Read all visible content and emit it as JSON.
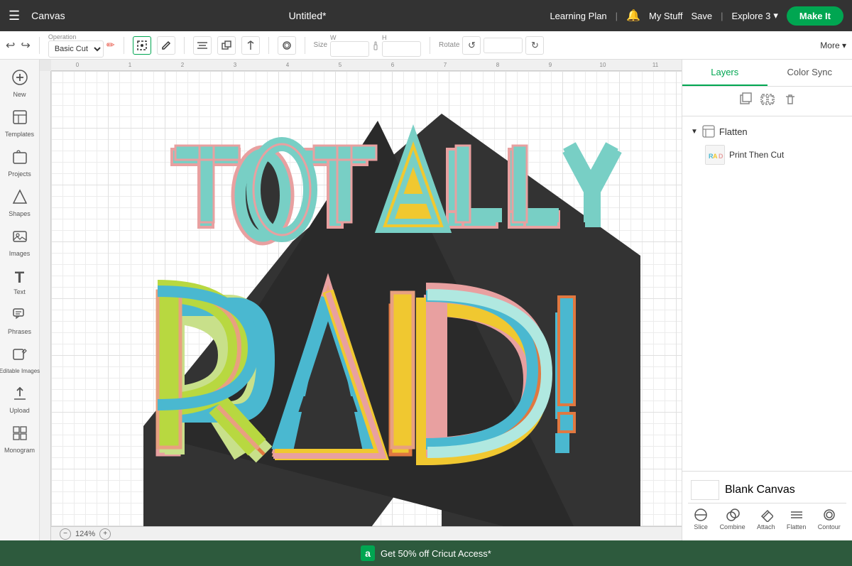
{
  "topNav": {
    "hamburger": "☰",
    "canvas_label": "Canvas",
    "title": "Untitled*",
    "learning_plan": "Learning Plan",
    "bell": "🔔",
    "my_stuff": "My Stuff",
    "save": "Save",
    "explore": "Explore 3",
    "make_it": "Make It"
  },
  "toolbar": {
    "undo": "↩",
    "redo": "↪",
    "operation_label": "Operation",
    "operation_value": "Basic Cut",
    "select_all": "Select All",
    "edit": "Edit",
    "align": "Align",
    "arrange": "Arrange",
    "flip": "Flip",
    "offset": "Offset",
    "size_label": "Size",
    "size_w": "W",
    "size_h": "H",
    "rotate": "Rotate",
    "more": "More ▾"
  },
  "sidebar": {
    "items": [
      {
        "icon": "⊕",
        "label": "New"
      },
      {
        "icon": "▤",
        "label": "Templates"
      },
      {
        "icon": "📁",
        "label": "Projects"
      },
      {
        "icon": "⬟",
        "label": "Shapes"
      },
      {
        "icon": "🖼",
        "label": "Images"
      },
      {
        "icon": "T",
        "label": "Text"
      },
      {
        "icon": "💬",
        "label": "Phrases"
      },
      {
        "icon": "✏",
        "label": "Editable\nImages"
      },
      {
        "icon": "⬆",
        "label": "Upload"
      },
      {
        "icon": "⊞",
        "label": "Monogram"
      }
    ]
  },
  "rightPanel": {
    "tabs": [
      {
        "label": "Layers",
        "active": true
      },
      {
        "label": "Color Sync",
        "active": false
      }
    ],
    "toolbar_icons": [
      "⧉",
      "⧊",
      "🗑"
    ],
    "layers": [
      {
        "type": "group",
        "label": "Flatten",
        "expanded": true,
        "children": [
          {
            "label": "Print Then Cut",
            "has_thumb": true
          }
        ]
      }
    ],
    "blank_canvas": "Blank Canvas",
    "bottom_actions": [
      {
        "icon": "✂",
        "label": "Slice"
      },
      {
        "icon": "⊕",
        "label": "Combine"
      },
      {
        "icon": "🔗",
        "label": "Attach"
      },
      {
        "icon": "⊞",
        "label": "Flatten"
      },
      {
        "icon": "◎",
        "label": "Contour"
      }
    ]
  },
  "zoom": {
    "level": "124%",
    "minus_icon": "−",
    "plus_icon": "+"
  },
  "promo": {
    "icon_text": "a",
    "text": "Get 50% off Cricut Access*"
  },
  "ruler": {
    "ticks": [
      "0",
      "1",
      "2",
      "3",
      "4",
      "5",
      "6",
      "7",
      "8",
      "9",
      "10",
      "11"
    ]
  }
}
